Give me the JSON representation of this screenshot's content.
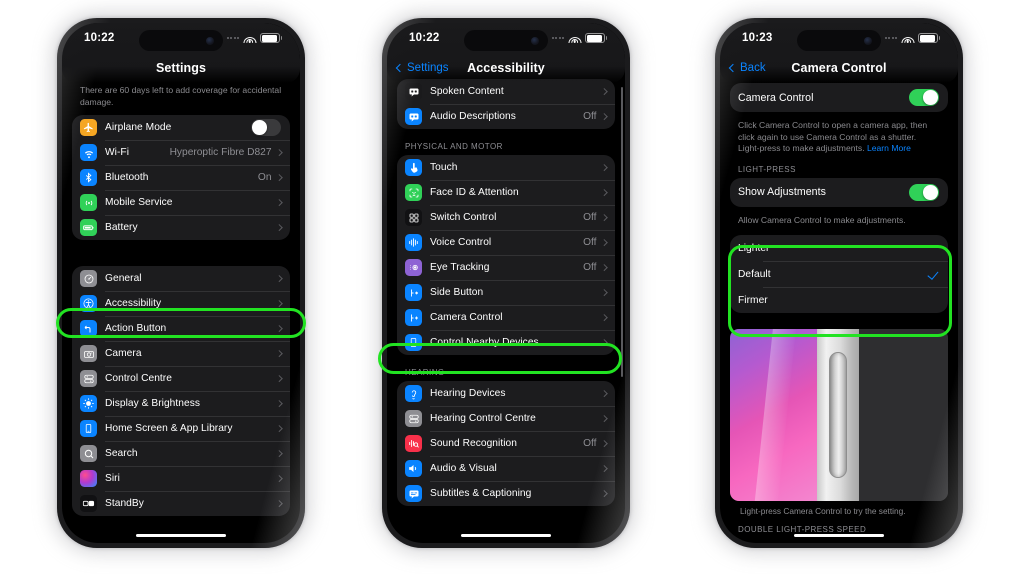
{
  "meta": {
    "accent_green": "#22e322",
    "ios_blue": "#0a84ff",
    "toggle_on": "#30d158",
    "page_background": "#ffffff"
  },
  "phones": [
    {
      "id": "phone-settings",
      "status": {
        "time": "10:22",
        "wifi_icon": "wifi-icon",
        "battery_icon": "battery-icon",
        "signal_icon": "cellular-dots-icon"
      },
      "nav": {
        "title": "Settings",
        "back_label": ""
      },
      "banner": "There are 60 days left to add coverage for accidental damage.",
      "groups": [
        {
          "rows": [
            {
              "icon": "airplane-icon",
              "icon_glyph": "✈",
              "icon_bg": "#f5a623",
              "label": "Airplane Mode",
              "value": "",
              "accessory": "toggle-off"
            },
            {
              "icon": "wifi-icon",
              "icon_glyph": "",
              "icon_bg": "#0a84ff",
              "label": "Wi-Fi",
              "value": "Hyperoptic Fibre D827",
              "accessory": "chevron"
            },
            {
              "icon": "bluetooth-icon",
              "icon_glyph": "ᛦ",
              "icon_bg": "#0a84ff",
              "label": "Bluetooth",
              "value": "On",
              "accessory": "chevron"
            },
            {
              "icon": "mobile-service-icon",
              "icon_glyph": "(·)",
              "icon_bg": "#30d158",
              "label": "Mobile Service",
              "value": "",
              "accessory": "chevron"
            },
            {
              "icon": "battery-icon",
              "icon_glyph": "",
              "icon_bg": "#30d158",
              "label": "Battery",
              "value": "",
              "accessory": "chevron"
            }
          ]
        },
        {
          "rows": [
            {
              "icon": "general-gear-icon",
              "icon_glyph": "⚙",
              "icon_bg": "#8e8e93",
              "label": "General",
              "value": "",
              "accessory": "chevron"
            },
            {
              "icon": "accessibility-icon",
              "icon_glyph": "Ⓙ",
              "icon_bg": "#0a84ff",
              "label": "Accessibility",
              "value": "",
              "accessory": "chevron",
              "highlighted": true
            },
            {
              "icon": "action-button-icon",
              "icon_glyph": "↳",
              "icon_bg": "#0a84ff",
              "label": "Action Button",
              "value": "",
              "accessory": "chevron"
            },
            {
              "icon": "camera-icon",
              "icon_glyph": "◉",
              "icon_bg": "#8e8e93",
              "label": "Camera",
              "value": "",
              "accessory": "chevron"
            },
            {
              "icon": "control-centre-icon",
              "icon_glyph": "⌸",
              "icon_bg": "#8e8e93",
              "label": "Control Centre",
              "value": "",
              "accessory": "chevron"
            },
            {
              "icon": "display-brightness-icon",
              "icon_glyph": "☀",
              "icon_bg": "#0a84ff",
              "label": "Display & Brightness",
              "value": "",
              "accessory": "chevron"
            },
            {
              "icon": "home-screen-icon",
              "icon_glyph": "▯",
              "icon_bg": "#0a84ff",
              "label": "Home Screen & App Library",
              "value": "",
              "accessory": "chevron"
            },
            {
              "icon": "search-icon",
              "icon_glyph": "⌕",
              "icon_bg": "#8e8e93",
              "label": "Search",
              "value": "",
              "accessory": "chevron"
            },
            {
              "icon": "siri-icon",
              "icon_glyph": "●",
              "icon_bg": "#b5417a",
              "label": "Siri",
              "value": "",
              "accessory": "chevron"
            },
            {
              "icon": "standby-icon",
              "icon_glyph": "▣",
              "icon_bg": "#111113",
              "label": "StandBy",
              "value": "",
              "accessory": "chevron"
            }
          ]
        }
      ]
    },
    {
      "id": "phone-accessibility",
      "status": {
        "time": "10:22",
        "wifi_icon": "wifi-icon",
        "battery_icon": "battery-icon",
        "signal_icon": "cellular-dots-icon"
      },
      "nav": {
        "title": "Accessibility",
        "back_label": "Settings"
      },
      "groups": [
        {
          "header": "",
          "rows": [
            {
              "icon": "spoken-content-icon",
              "icon_glyph": "☰",
              "icon_bg": "#1a1a1c",
              "label": "Spoken Content",
              "value": "",
              "accessory": "chevron"
            },
            {
              "icon": "audio-descriptions-icon",
              "icon_glyph": "☰",
              "icon_bg": "#0a84ff",
              "label": "Audio Descriptions",
              "value": "Off",
              "accessory": "chevron"
            }
          ]
        },
        {
          "header": "PHYSICAL AND MOTOR",
          "rows": [
            {
              "icon": "touch-icon",
              "icon_glyph": "☝",
              "icon_bg": "#0a84ff",
              "label": "Touch",
              "value": "",
              "accessory": "chevron"
            },
            {
              "icon": "face-id-icon",
              "icon_glyph": "☺",
              "icon_bg": "#30d158",
              "label": "Face ID & Attention",
              "value": "",
              "accessory": "chevron"
            },
            {
              "icon": "switch-control-icon",
              "icon_glyph": "∷",
              "icon_bg": "#111113",
              "label": "Switch Control",
              "value": "Off",
              "accessory": "chevron"
            },
            {
              "icon": "voice-control-icon",
              "icon_glyph": "‖",
              "icon_bg": "#0a84ff",
              "label": "Voice Control",
              "value": "Off",
              "accessory": "chevron"
            },
            {
              "icon": "eye-tracking-icon",
              "icon_glyph": "◉",
              "icon_bg": "#8e63d4",
              "label": "Eye Tracking",
              "value": "Off",
              "accessory": "chevron"
            },
            {
              "icon": "side-button-icon",
              "icon_glyph": "⇥",
              "icon_bg": "#0a84ff",
              "label": "Side Button",
              "value": "",
              "accessory": "chevron"
            },
            {
              "icon": "camera-control-icon",
              "icon_glyph": "⇥",
              "icon_bg": "#0a84ff",
              "label": "Camera Control",
              "value": "",
              "accessory": "chevron",
              "highlighted": true
            },
            {
              "icon": "control-nearby-devices-icon",
              "icon_glyph": "▯",
              "icon_bg": "#0a84ff",
              "label": "Control Nearby Devices",
              "value": "",
              "accessory": "chevron"
            }
          ]
        },
        {
          "header": "HEARING",
          "rows": [
            {
              "icon": "hearing-devices-icon",
              "icon_glyph": "ʘ",
              "icon_bg": "#0a84ff",
              "label": "Hearing Devices",
              "value": "",
              "accessory": "chevron"
            },
            {
              "icon": "hearing-control-centre-icon",
              "icon_glyph": "⌸",
              "icon_bg": "#8e8e93",
              "label": "Hearing Control Centre",
              "value": "",
              "accessory": "chevron"
            },
            {
              "icon": "sound-recognition-icon",
              "icon_glyph": "‖",
              "icon_bg": "#f8304a",
              "label": "Sound Recognition",
              "value": "Off",
              "accessory": "chevron"
            },
            {
              "icon": "audio-visual-icon",
              "icon_glyph": "◂",
              "icon_bg": "#0a84ff",
              "label": "Audio & Visual",
              "value": "",
              "accessory": "chevron"
            },
            {
              "icon": "subtitles-captioning-icon",
              "icon_glyph": "☰",
              "icon_bg": "#0a84ff",
              "label": "Subtitles & Captioning",
              "value": "",
              "accessory": "chevron"
            }
          ]
        }
      ]
    },
    {
      "id": "phone-camera-control",
      "status": {
        "time": "10:23",
        "wifi_icon": "wifi-icon",
        "battery_icon": "battery-icon",
        "signal_icon": "cellular-dots-icon"
      },
      "nav": {
        "title": "Camera Control",
        "back_label": "Back"
      },
      "main_toggle": {
        "label": "Camera Control",
        "state": "on"
      },
      "main_footnote": "Click Camera Control to open a camera app, then click again to use Camera Control as a shutter. Light-press to make adjustments.",
      "main_footnote_link": "Learn More",
      "light_press_header": "LIGHT-PRESS",
      "adjust_toggle": {
        "label": "Show Adjustments",
        "state": "on"
      },
      "adjust_footnote": "Allow Camera Control to make adjustments.",
      "pressure_options": [
        {
          "label": "Lighter",
          "selected": false
        },
        {
          "label": "Default",
          "selected": true
        },
        {
          "label": "Firmer",
          "selected": false
        }
      ],
      "preview_caption": "Light-press Camera Control to try the setting.",
      "bottom_header": "DOUBLE LIGHT-PRESS SPEED"
    }
  ]
}
